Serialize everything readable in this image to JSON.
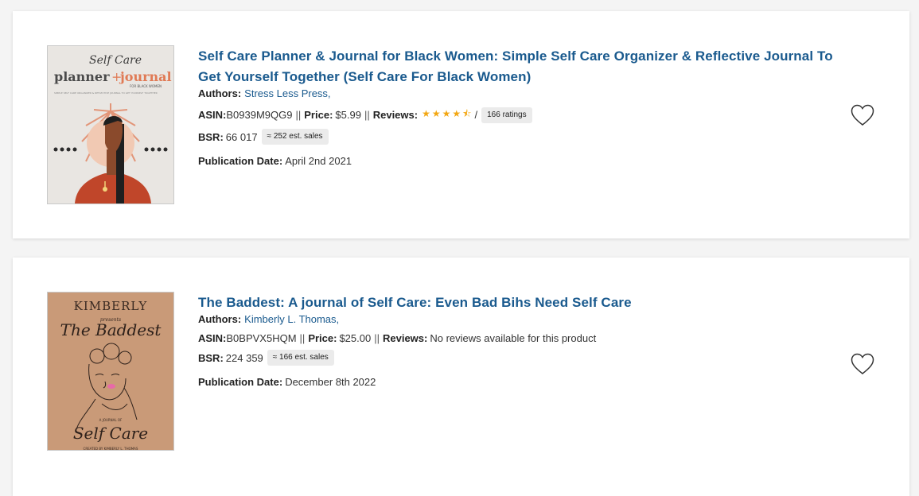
{
  "results": [
    {
      "title": "Self Care Planner & Journal for Black Women: Simple Self Care Organizer & Reflective Journal To Get Yourself Together (Self Care For Black Women)",
      "authors_label": "Authors:",
      "authors": "Stress Less Press,",
      "asin_label": "ASIN:",
      "asin": "B0939M9QG9",
      "price_label": "Price:",
      "price": "$5.99",
      "reviews_label": "Reviews:",
      "rating": 4.5,
      "stars": "★★★★⯪",
      "rating_separator": "/",
      "ratings_count": "166 ratings",
      "bsr_label": "BSR:",
      "bsr": "66 017",
      "est_sales": "≈ 252 est. sales",
      "pub_label": "Publication Date:",
      "pub_date": "April 2nd 2021",
      "cover": {
        "script": "Self Care",
        "word1": "planner",
        "plus": "+",
        "word2": "journal",
        "sub": "FOR BLACK WOMEN",
        "tagline": "SIMPLE SELF CARE ORGANIZER & REFLECTIVE JOURNAL TO GET YOURSELF TOGETHER"
      }
    },
    {
      "title": "The Baddest: A journal of Self Care: Even Bad Bihs Need Self Care",
      "authors_label": "Authors:",
      "authors": "Kimberly L. Thomas,",
      "asin_label": "ASIN:",
      "asin": "B0BPVX5HQM",
      "price_label": "Price:",
      "price": "$25.00",
      "reviews_label": "Reviews:",
      "reviews_text": "No reviews available for this product",
      "bsr_label": "BSR:",
      "bsr": "224 359",
      "est_sales": "≈ 166 est. sales",
      "pub_label": "Publication Date:",
      "pub_date": "December 8th 2022",
      "cover": {
        "top": "KIMBERLY",
        "presents": "presents",
        "title": "The Baddest",
        "sub": "A JOURNAL OF",
        "bottom": "Self Care",
        "credit": "CREATED BY KIMBERLY L. THOMAS"
      }
    }
  ],
  "separator": "||",
  "icons": {
    "favorite": "heart-outline-icon",
    "rating": "star-icon"
  },
  "colors": {
    "link": "#1a5a8e",
    "star": "#f3a712",
    "pill_bg": "#ebebeb"
  }
}
